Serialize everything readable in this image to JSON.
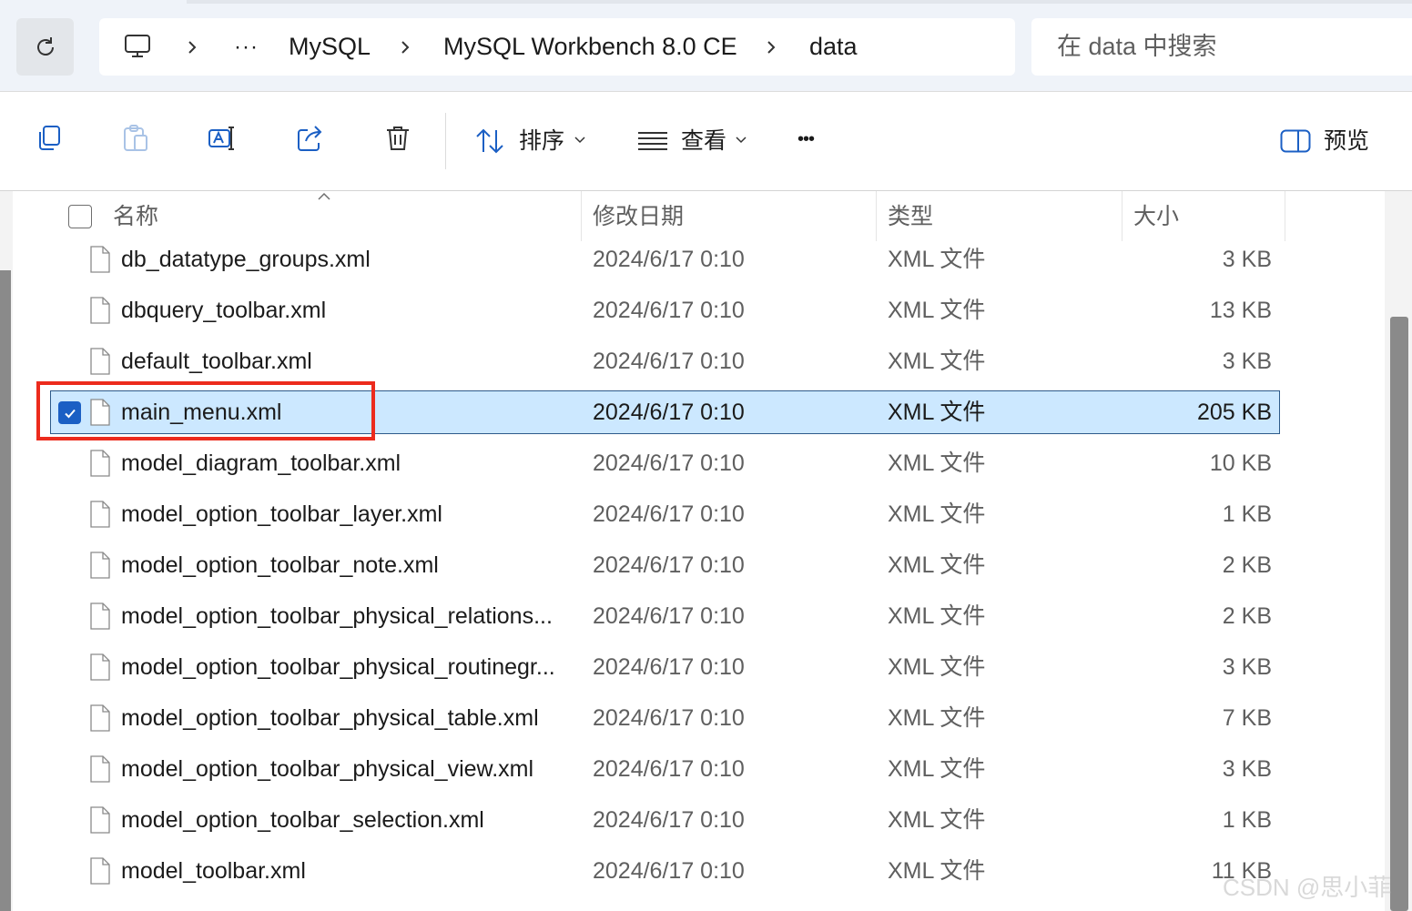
{
  "address_bar": {
    "breadcrumb": [
      "MySQL",
      "MySQL Workbench 8.0 CE",
      "data"
    ],
    "overflow": "···",
    "search_placeholder": "在 data 中搜索"
  },
  "toolbar": {
    "sort_label": "排序",
    "view_label": "查看",
    "more_label": "•••",
    "preview_label": "预览"
  },
  "columns": {
    "name": "名称",
    "date": "修改日期",
    "type": "类型",
    "size": "大小"
  },
  "files": [
    {
      "name": "db_datatype_groups.xml",
      "date": "2024/6/17 0:10",
      "type": "XML 文件",
      "size": "3 KB"
    },
    {
      "name": "dbquery_toolbar.xml",
      "date": "2024/6/17 0:10",
      "type": "XML 文件",
      "size": "13 KB"
    },
    {
      "name": "default_toolbar.xml",
      "date": "2024/6/17 0:10",
      "type": "XML 文件",
      "size": "3 KB"
    },
    {
      "name": "main_menu.xml",
      "date": "2024/6/17 0:10",
      "type": "XML 文件",
      "size": "205 KB",
      "selected": true
    },
    {
      "name": "model_diagram_toolbar.xml",
      "date": "2024/6/17 0:10",
      "type": "XML 文件",
      "size": "10 KB"
    },
    {
      "name": "model_option_toolbar_layer.xml",
      "date": "2024/6/17 0:10",
      "type": "XML 文件",
      "size": "1 KB"
    },
    {
      "name": "model_option_toolbar_note.xml",
      "date": "2024/6/17 0:10",
      "type": "XML 文件",
      "size": "2 KB"
    },
    {
      "name": "model_option_toolbar_physical_relations...",
      "date": "2024/6/17 0:10",
      "type": "XML 文件",
      "size": "2 KB"
    },
    {
      "name": "model_option_toolbar_physical_routinegr...",
      "date": "2024/6/17 0:10",
      "type": "XML 文件",
      "size": "3 KB"
    },
    {
      "name": "model_option_toolbar_physical_table.xml",
      "date": "2024/6/17 0:10",
      "type": "XML 文件",
      "size": "7 KB"
    },
    {
      "name": "model_option_toolbar_physical_view.xml",
      "date": "2024/6/17 0:10",
      "type": "XML 文件",
      "size": "3 KB"
    },
    {
      "name": "model_option_toolbar_selection.xml",
      "date": "2024/6/17 0:10",
      "type": "XML 文件",
      "size": "1 KB"
    },
    {
      "name": "model_toolbar.xml",
      "date": "2024/6/17 0:10",
      "type": "XML 文件",
      "size": "11 KB"
    }
  ],
  "watermark": "CSDN @思小菲",
  "colors": {
    "selection": "#cce8ff",
    "checkbox_blue": "#1b5fc4",
    "highlight_red": "#ec2b1d"
  }
}
